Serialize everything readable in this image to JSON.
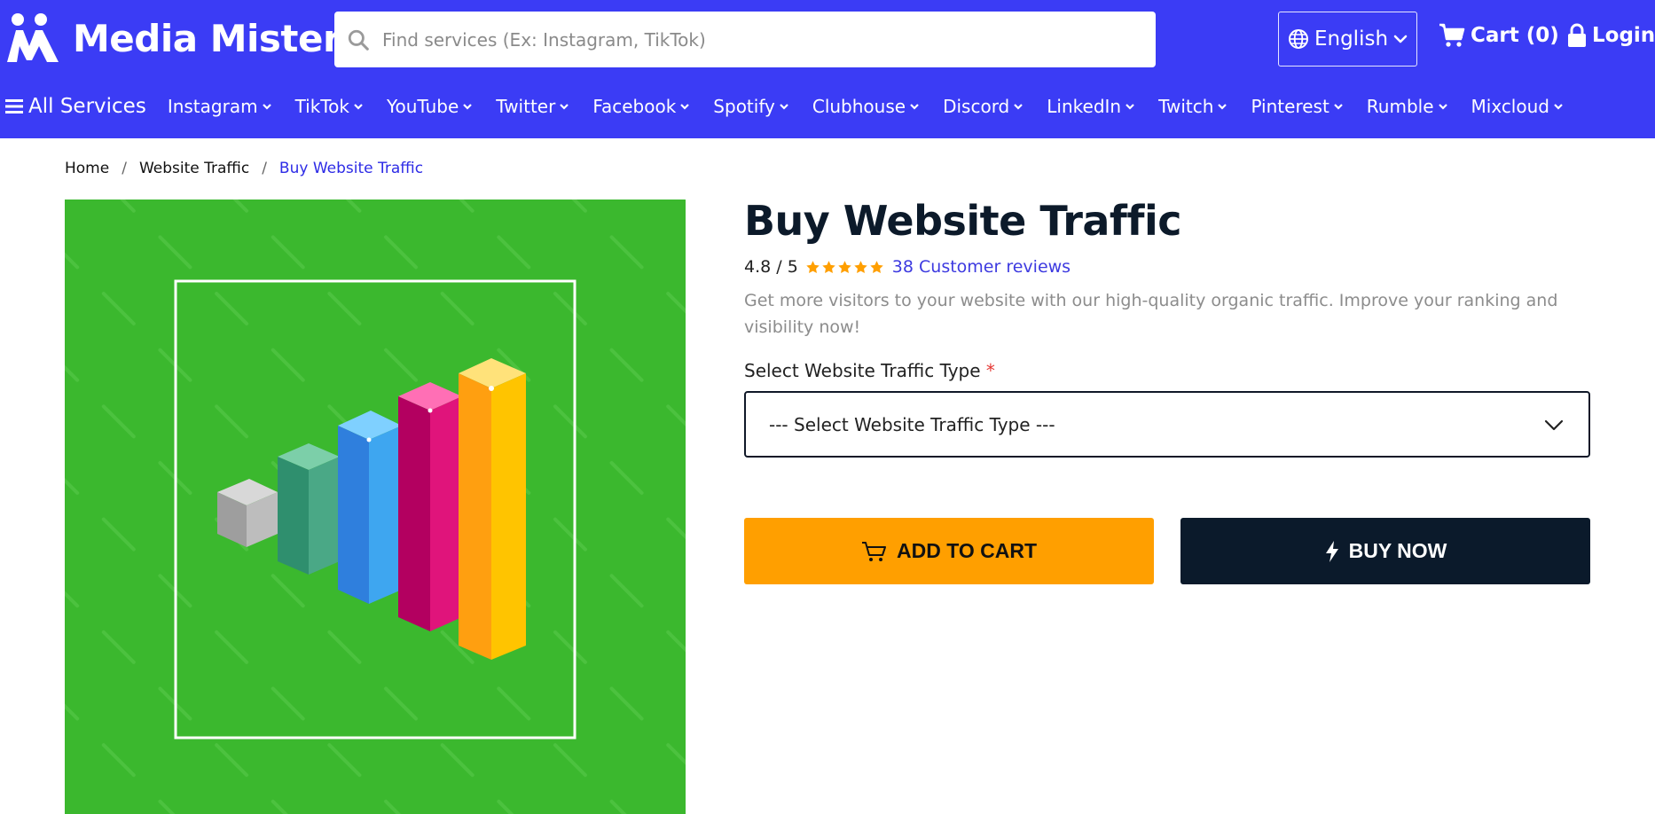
{
  "brand": {
    "name": "Media Mister"
  },
  "search": {
    "placeholder": "Find services (Ex: Instagram, TikTok)",
    "value": ""
  },
  "header": {
    "language": "English",
    "cart_label": "Cart (0)",
    "login_label": "Login"
  },
  "nav": {
    "all_services": "All Services",
    "items": [
      "Instagram",
      "TikTok",
      "YouTube",
      "Twitter",
      "Facebook",
      "Spotify",
      "Clubhouse",
      "Discord",
      "LinkedIn",
      "Twitch",
      "Pinterest",
      "Rumble",
      "Mixcloud"
    ]
  },
  "breadcrumb": {
    "items": [
      "Home",
      "Website Traffic",
      "Buy Website Traffic"
    ],
    "separator": "/"
  },
  "product": {
    "title": "Buy Website Traffic",
    "rating_text": "4.8 / 5",
    "rating_value": 4.8,
    "rating_max": 5,
    "reviews_label": "38 Customer reviews",
    "description": "Get more visitors to your website with our high-quality organic traffic. Improve your ranking and visibility now!",
    "select_label": "Select Website Traffic Type",
    "required_mark": "*",
    "select_placeholder": "--- Select Website Traffic Type ---",
    "add_to_cart": "ADD TO CART",
    "buy_now": "BUY NOW"
  },
  "colors": {
    "header_bg": "#3b3cf5",
    "image_bg": "#3bb82e",
    "accent_orange": "#ff9f00",
    "dark_navy": "#0b1a2b",
    "link_blue": "#3d3ae0",
    "star": "#ff9f00"
  },
  "icons": {
    "search": "search-icon",
    "language": "globe-icon",
    "cart": "cart-icon",
    "login": "lock-icon",
    "menu": "menu-icon",
    "dropdown": "chevron-down-icon",
    "add_to_cart": "cart-outline-icon",
    "buy_now": "bolt-icon"
  }
}
